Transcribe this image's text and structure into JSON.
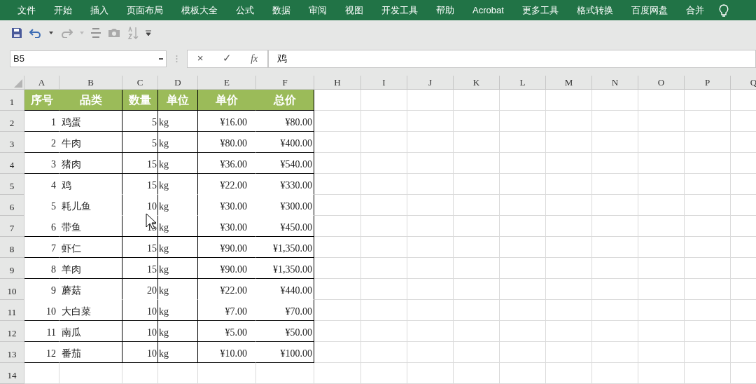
{
  "menu": [
    "文件",
    "开始",
    "插入",
    "页面布局",
    "模板大全",
    "公式",
    "数据",
    "审阅",
    "视图",
    "开发工具",
    "帮助",
    "Acrobat",
    "更多工具",
    "格式转换",
    "百度网盘",
    "合并"
  ],
  "name_box": "B5",
  "formula_buttons": [
    "×",
    "✓",
    "fx"
  ],
  "formula": "鸡",
  "columns": [
    "A",
    "B",
    "C",
    "D",
    "E",
    "F",
    "H",
    "I",
    "J",
    "K",
    "L",
    "M",
    "N",
    "O",
    "P",
    "Q"
  ],
  "rows": [
    {
      "number": "1",
      "kind": "header",
      "border_below": true,
      "cells": [
        "序号",
        "品类",
        "数量",
        "单位",
        "单价",
        "总价"
      ]
    },
    {
      "number": "2",
      "kind": "data",
      "border_below": true,
      "cells": [
        "1",
        "鸡蛋",
        "5",
        "kg",
        "¥16.00",
        "¥80.00"
      ]
    },
    {
      "number": "3",
      "kind": "data",
      "border_below": true,
      "cells": [
        "2",
        "牛肉",
        "5",
        "kg",
        "¥80.00",
        "¥400.00"
      ]
    },
    {
      "number": "4",
      "kind": "data",
      "border_below": true,
      "cells": [
        "3",
        "猪肉",
        "15",
        "kg",
        "¥36.00",
        "¥540.00"
      ]
    },
    {
      "number": "5",
      "kind": "data",
      "border_below": false,
      "cells": [
        "4",
        "鸡",
        "15",
        "kg",
        "¥22.00",
        "¥330.00"
      ]
    },
    {
      "number": "6",
      "kind": "data",
      "border_below": false,
      "cells": [
        "5",
        "耗儿鱼",
        "10",
        "kg",
        "¥30.00",
        "¥300.00"
      ]
    },
    {
      "number": "7",
      "kind": "data",
      "border_below": true,
      "cells": [
        "6",
        "带鱼",
        "15",
        "kg",
        "¥30.00",
        "¥450.00"
      ]
    },
    {
      "number": "8",
      "kind": "data",
      "border_below": true,
      "cells": [
        "7",
        "虾仁",
        "15",
        "kg",
        "¥90.00",
        "¥1,350.00"
      ]
    },
    {
      "number": "9",
      "kind": "data",
      "border_below": true,
      "cells": [
        "8",
        "羊肉",
        "15",
        "kg",
        "¥90.00",
        "¥1,350.00"
      ]
    },
    {
      "number": "10",
      "kind": "data",
      "border_below": false,
      "cells": [
        "9",
        "蘑菇",
        "20",
        "kg",
        "¥22.00",
        "¥440.00"
      ]
    },
    {
      "number": "11",
      "kind": "data",
      "border_below": true,
      "cells": [
        "10",
        "大白菜",
        "10",
        "kg",
        "¥7.00",
        "¥70.00"
      ]
    },
    {
      "number": "12",
      "kind": "data",
      "border_below": true,
      "cells": [
        "11",
        "南瓜",
        "10",
        "kg",
        "¥5.00",
        "¥50.00"
      ]
    },
    {
      "number": "13",
      "kind": "data",
      "border_below": true,
      "cells": [
        "12",
        "番茄",
        "10",
        "kg",
        "¥10.00",
        "¥100.00"
      ]
    },
    {
      "number": "14",
      "kind": "empty",
      "cells": []
    }
  ]
}
